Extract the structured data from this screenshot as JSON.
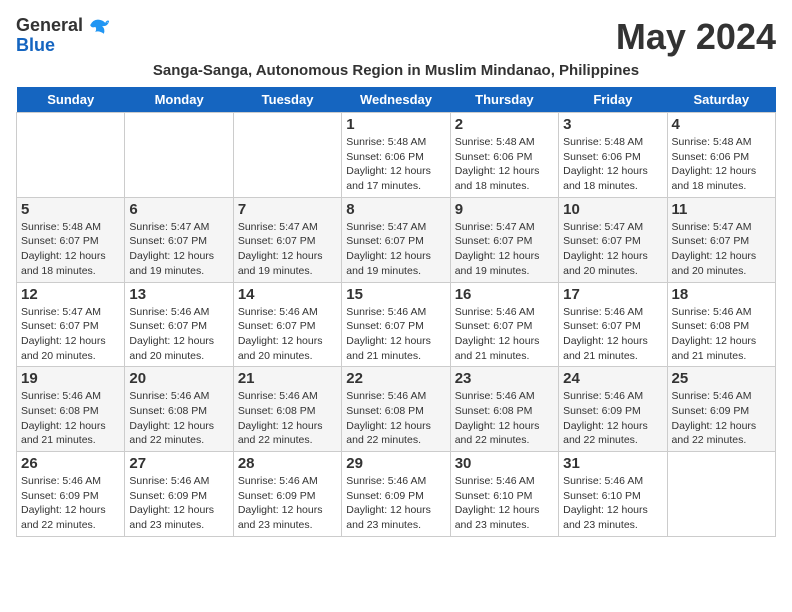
{
  "logo": {
    "general": "General",
    "blue": "Blue"
  },
  "title": "May 2024",
  "subtitle": "Sanga-Sanga, Autonomous Region in Muslim Mindanao, Philippines",
  "days": [
    "Sunday",
    "Monday",
    "Tuesday",
    "Wednesday",
    "Thursday",
    "Friday",
    "Saturday"
  ],
  "weeks": [
    [
      {
        "date": "",
        "info": ""
      },
      {
        "date": "",
        "info": ""
      },
      {
        "date": "",
        "info": ""
      },
      {
        "date": "1",
        "info": "Sunrise: 5:48 AM\nSunset: 6:06 PM\nDaylight: 12 hours\nand 17 minutes."
      },
      {
        "date": "2",
        "info": "Sunrise: 5:48 AM\nSunset: 6:06 PM\nDaylight: 12 hours\nand 18 minutes."
      },
      {
        "date": "3",
        "info": "Sunrise: 5:48 AM\nSunset: 6:06 PM\nDaylight: 12 hours\nand 18 minutes."
      },
      {
        "date": "4",
        "info": "Sunrise: 5:48 AM\nSunset: 6:06 PM\nDaylight: 12 hours\nand 18 minutes."
      }
    ],
    [
      {
        "date": "5",
        "info": "Sunrise: 5:48 AM\nSunset: 6:07 PM\nDaylight: 12 hours\nand 18 minutes."
      },
      {
        "date": "6",
        "info": "Sunrise: 5:47 AM\nSunset: 6:07 PM\nDaylight: 12 hours\nand 19 minutes."
      },
      {
        "date": "7",
        "info": "Sunrise: 5:47 AM\nSunset: 6:07 PM\nDaylight: 12 hours\nand 19 minutes."
      },
      {
        "date": "8",
        "info": "Sunrise: 5:47 AM\nSunset: 6:07 PM\nDaylight: 12 hours\nand 19 minutes."
      },
      {
        "date": "9",
        "info": "Sunrise: 5:47 AM\nSunset: 6:07 PM\nDaylight: 12 hours\nand 19 minutes."
      },
      {
        "date": "10",
        "info": "Sunrise: 5:47 AM\nSunset: 6:07 PM\nDaylight: 12 hours\nand 20 minutes."
      },
      {
        "date": "11",
        "info": "Sunrise: 5:47 AM\nSunset: 6:07 PM\nDaylight: 12 hours\nand 20 minutes."
      }
    ],
    [
      {
        "date": "12",
        "info": "Sunrise: 5:47 AM\nSunset: 6:07 PM\nDaylight: 12 hours\nand 20 minutes."
      },
      {
        "date": "13",
        "info": "Sunrise: 5:46 AM\nSunset: 6:07 PM\nDaylight: 12 hours\nand 20 minutes."
      },
      {
        "date": "14",
        "info": "Sunrise: 5:46 AM\nSunset: 6:07 PM\nDaylight: 12 hours\nand 20 minutes."
      },
      {
        "date": "15",
        "info": "Sunrise: 5:46 AM\nSunset: 6:07 PM\nDaylight: 12 hours\nand 21 minutes."
      },
      {
        "date": "16",
        "info": "Sunrise: 5:46 AM\nSunset: 6:07 PM\nDaylight: 12 hours\nand 21 minutes."
      },
      {
        "date": "17",
        "info": "Sunrise: 5:46 AM\nSunset: 6:07 PM\nDaylight: 12 hours\nand 21 minutes."
      },
      {
        "date": "18",
        "info": "Sunrise: 5:46 AM\nSunset: 6:08 PM\nDaylight: 12 hours\nand 21 minutes."
      }
    ],
    [
      {
        "date": "19",
        "info": "Sunrise: 5:46 AM\nSunset: 6:08 PM\nDaylight: 12 hours\nand 21 minutes."
      },
      {
        "date": "20",
        "info": "Sunrise: 5:46 AM\nSunset: 6:08 PM\nDaylight: 12 hours\nand 22 minutes."
      },
      {
        "date": "21",
        "info": "Sunrise: 5:46 AM\nSunset: 6:08 PM\nDaylight: 12 hours\nand 22 minutes."
      },
      {
        "date": "22",
        "info": "Sunrise: 5:46 AM\nSunset: 6:08 PM\nDaylight: 12 hours\nand 22 minutes."
      },
      {
        "date": "23",
        "info": "Sunrise: 5:46 AM\nSunset: 6:08 PM\nDaylight: 12 hours\nand 22 minutes."
      },
      {
        "date": "24",
        "info": "Sunrise: 5:46 AM\nSunset: 6:09 PM\nDaylight: 12 hours\nand 22 minutes."
      },
      {
        "date": "25",
        "info": "Sunrise: 5:46 AM\nSunset: 6:09 PM\nDaylight: 12 hours\nand 22 minutes."
      }
    ],
    [
      {
        "date": "26",
        "info": "Sunrise: 5:46 AM\nSunset: 6:09 PM\nDaylight: 12 hours\nand 22 minutes."
      },
      {
        "date": "27",
        "info": "Sunrise: 5:46 AM\nSunset: 6:09 PM\nDaylight: 12 hours\nand 23 minutes."
      },
      {
        "date": "28",
        "info": "Sunrise: 5:46 AM\nSunset: 6:09 PM\nDaylight: 12 hours\nand 23 minutes."
      },
      {
        "date": "29",
        "info": "Sunrise: 5:46 AM\nSunset: 6:09 PM\nDaylight: 12 hours\nand 23 minutes."
      },
      {
        "date": "30",
        "info": "Sunrise: 5:46 AM\nSunset: 6:10 PM\nDaylight: 12 hours\nand 23 minutes."
      },
      {
        "date": "31",
        "info": "Sunrise: 5:46 AM\nSunset: 6:10 PM\nDaylight: 12 hours\nand 23 minutes."
      },
      {
        "date": "",
        "info": ""
      }
    ]
  ]
}
